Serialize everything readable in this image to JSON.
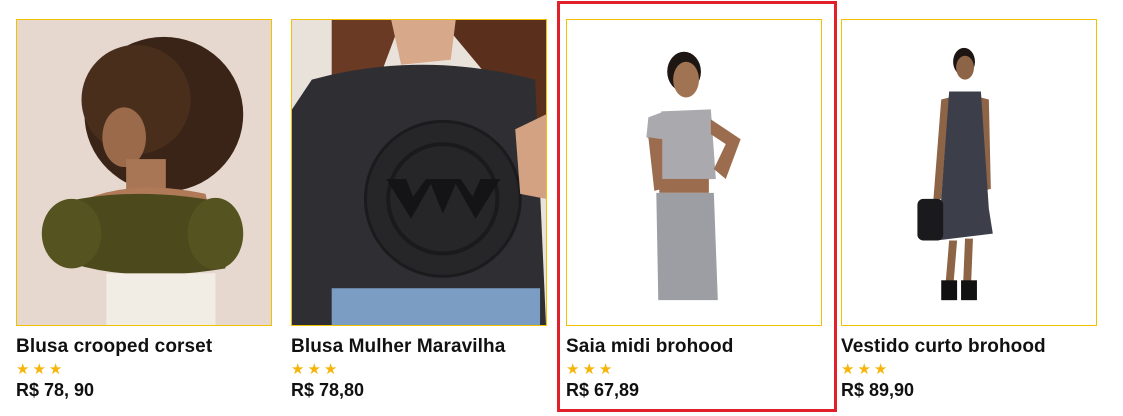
{
  "products": [
    {
      "name": "Blusa crooped corset",
      "rating_stars": "★★★",
      "rating": 3,
      "price": "R$ 78, 90",
      "image_alt": ""
    },
    {
      "name": "Blusa Mulher Maravilha",
      "rating_stars": "★★★",
      "rating": 3,
      "price": "R$ 78,80",
      "image_alt": ""
    },
    {
      "name": "Saia midi brohood",
      "rating_stars": "★★★",
      "rating": 3,
      "price": "R$ 67,89",
      "image_alt": ""
    },
    {
      "name": "Vestido curto brohood",
      "rating_stars": "★★★",
      "rating": 3,
      "price": "R$ 89,90",
      "image_alt": ""
    }
  ],
  "colors": {
    "frame_border": "#f2c200",
    "star": "#f5b50a",
    "highlight": "#e0202a"
  },
  "highlighted_product_index": 2
}
